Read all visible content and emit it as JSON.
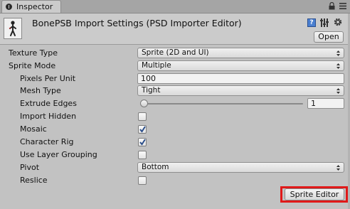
{
  "tab": {
    "label": "Inspector"
  },
  "header": {
    "title": "BonePSB Import Settings (PSD Importer Editor)",
    "open_label": "Open",
    "help_glyph": "?"
  },
  "properties": [
    {
      "label": "Texture Type",
      "indent": 0,
      "type": "dropdown",
      "value": "Sprite (2D and UI)"
    },
    {
      "label": "Sprite Mode",
      "indent": 0,
      "type": "dropdown",
      "value": "Multiple"
    },
    {
      "label": "Pixels Per Unit",
      "indent": 1,
      "type": "text",
      "value": "100"
    },
    {
      "label": "Mesh Type",
      "indent": 1,
      "type": "dropdown",
      "value": "Tight"
    },
    {
      "label": "Extrude Edges",
      "indent": 1,
      "type": "slider",
      "value": "1",
      "level": 0.03
    },
    {
      "label": "Import Hidden",
      "indent": 1,
      "type": "checkbox",
      "checked": false
    },
    {
      "label": "Mosaic",
      "indent": 1,
      "type": "checkbox",
      "checked": true
    },
    {
      "label": "Character Rig",
      "indent": 1,
      "type": "checkbox",
      "checked": true
    },
    {
      "label": "Use Layer Grouping",
      "indent": 1,
      "type": "checkbox",
      "checked": false
    },
    {
      "label": "Pivot",
      "indent": 1,
      "type": "dropdown",
      "value": "Bottom"
    },
    {
      "label": "Reslice",
      "indent": 1,
      "type": "checkbox",
      "checked": false
    }
  ],
  "footer": {
    "sprite_editor_label": "Sprite Editor"
  },
  "icons": {
    "tab": "inspector-icon",
    "lock": "lock-icon",
    "menu": "menu-icon",
    "asset": "psb-asset-icon",
    "help": "help-icon",
    "preset": "preset-icon",
    "gear": "gear-icon"
  },
  "colors": {
    "panel_bg": "#c2c2c2",
    "highlight": "#e01919",
    "check": "#2b4e8a"
  }
}
